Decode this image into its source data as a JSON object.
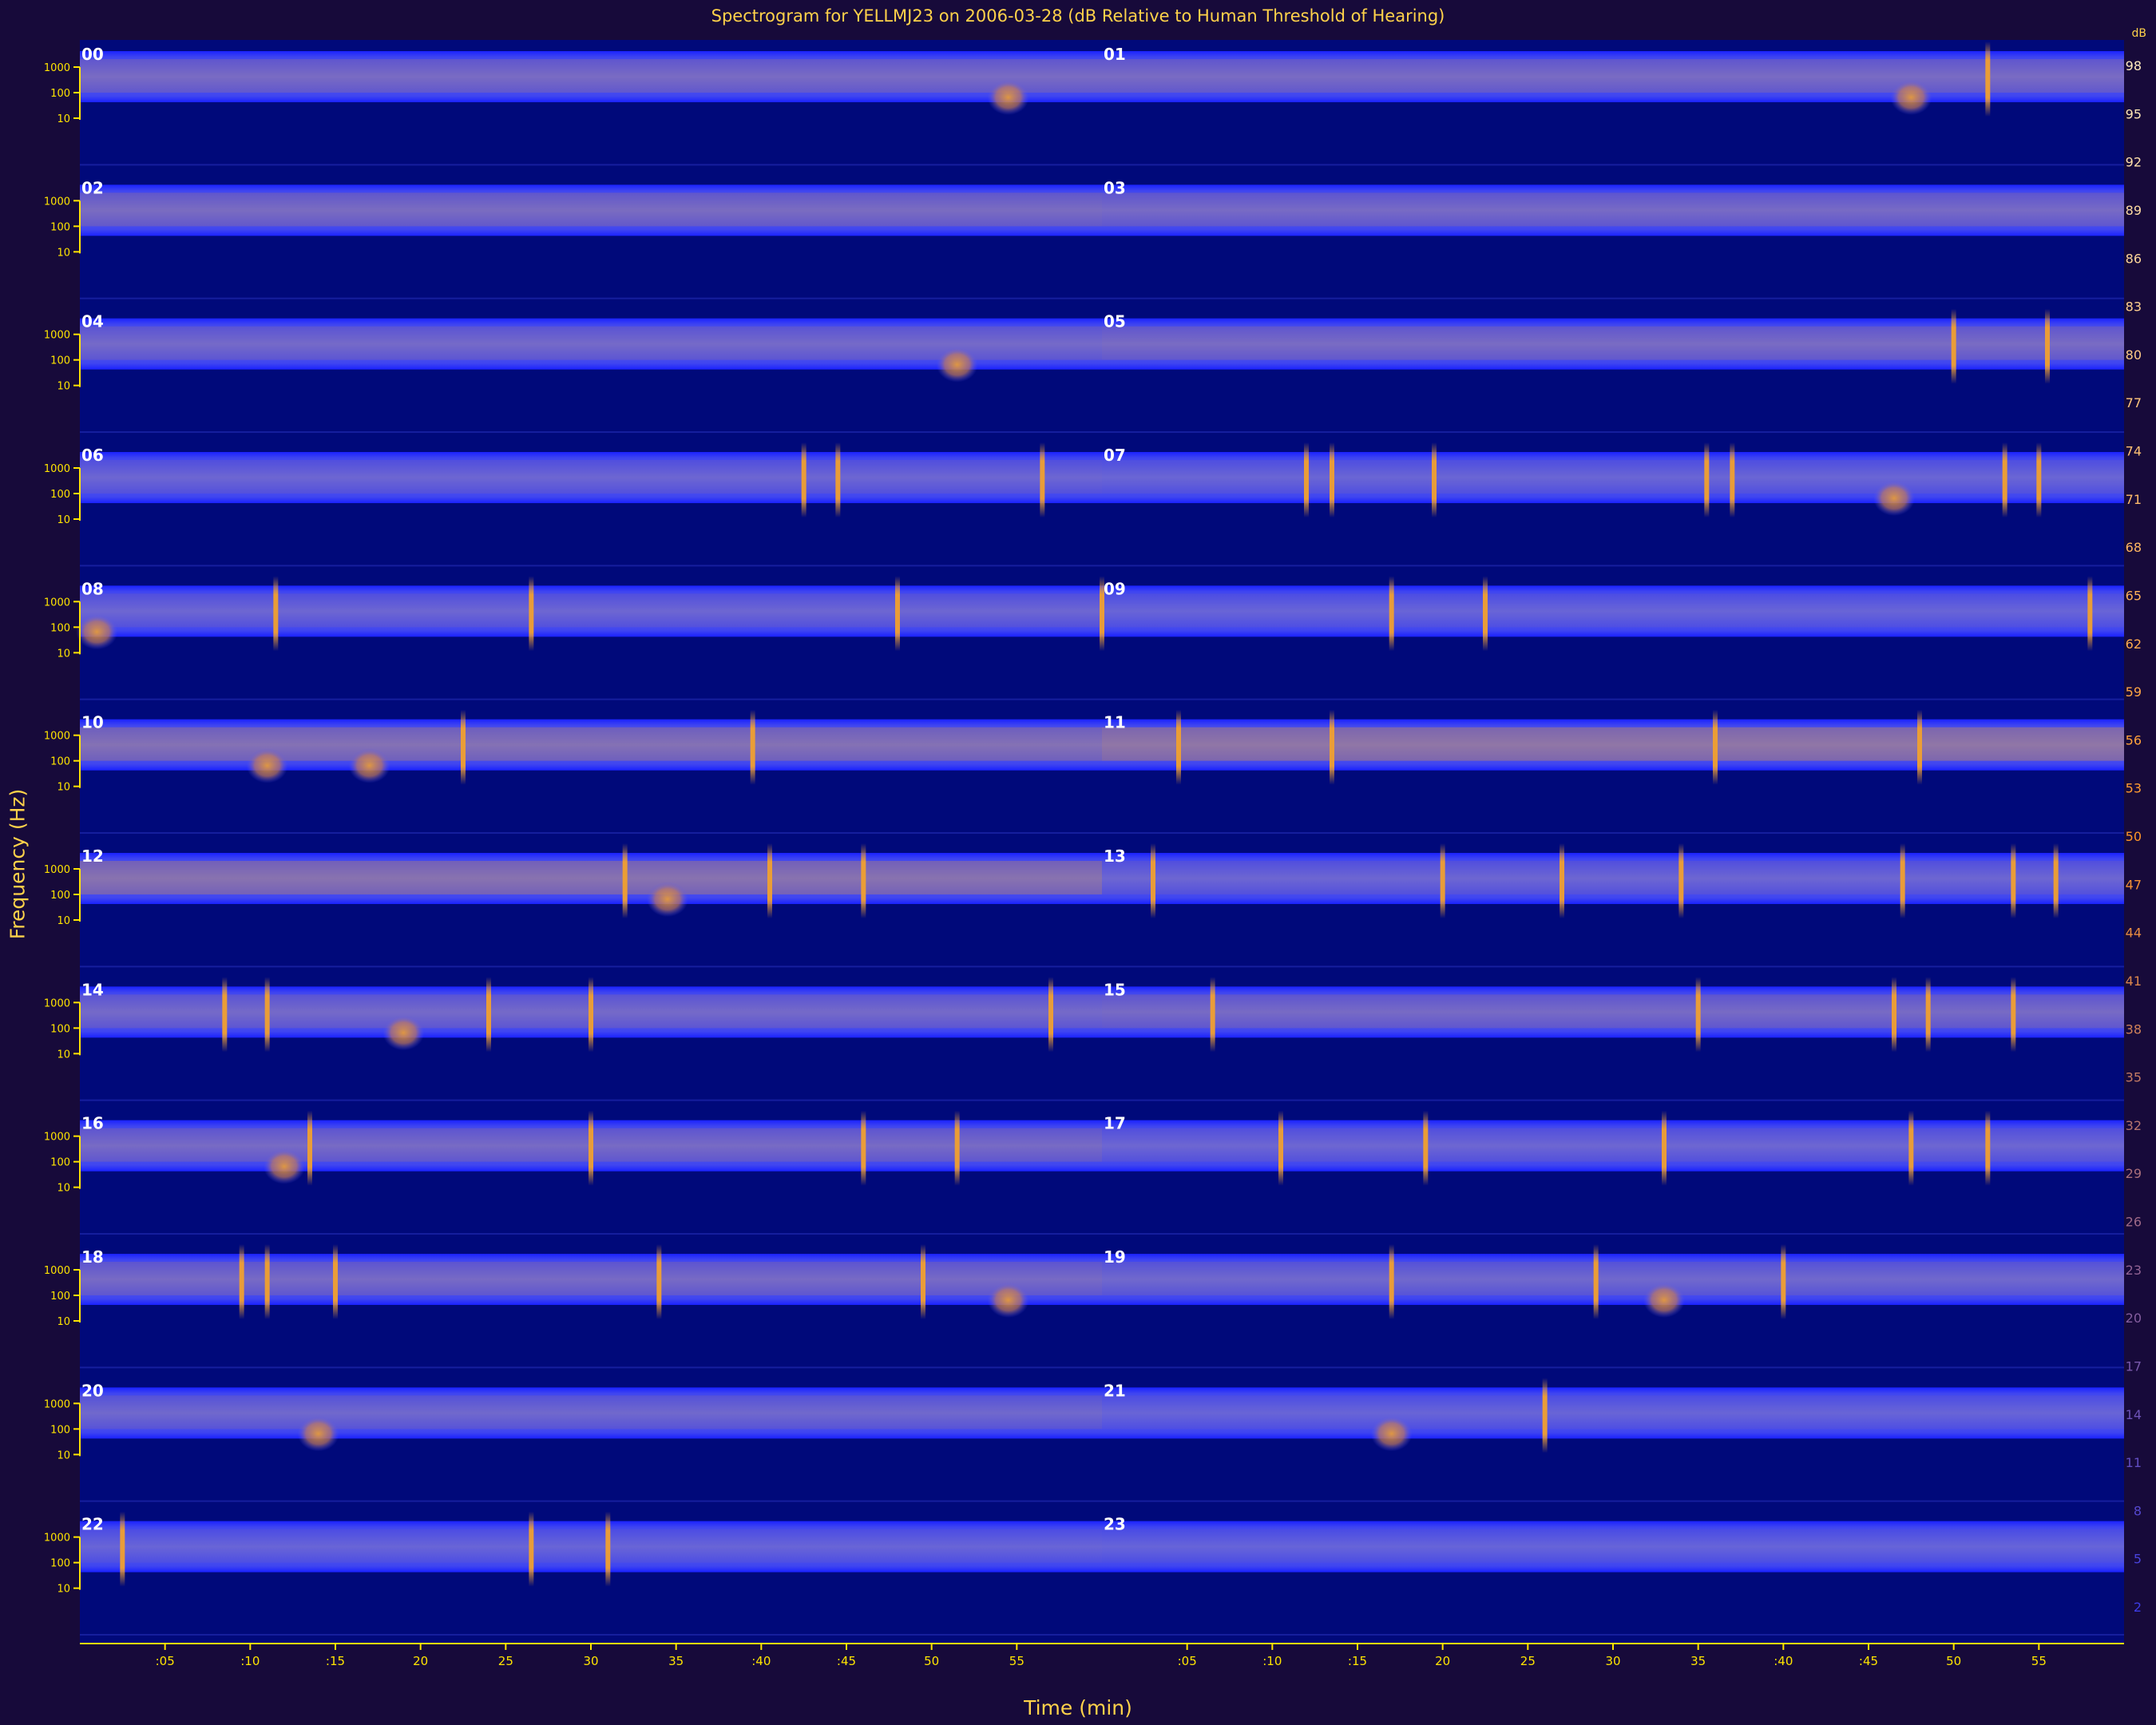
{
  "chart_data": {
    "type": "heatmap",
    "title": "Spectrogram for YELLMJ23 on 2006-03-28 (dB Relative to Human Threshold of Hearing)",
    "xlabel": "Time (min)",
    "ylabel": "Frequency (Hz)",
    "x_tick_labels": [
      ":05",
      ":10",
      ":15",
      "20",
      "25",
      "30",
      "35",
      ":40",
      ":45",
      "50",
      "55"
    ],
    "y_tick_labels": [
      "1000",
      "100",
      "10"
    ],
    "hour_labels": [
      "00",
      "01",
      "02",
      "03",
      "04",
      "05",
      "06",
      "07",
      "08",
      "09",
      "10",
      "11",
      "12",
      "13",
      "14",
      "15",
      "16",
      "17",
      "18",
      "19",
      "20",
      "21",
      "22",
      "23"
    ],
    "colorbar_unit": "dB",
    "colorbar_ticks": [
      98,
      95,
      92,
      89,
      86,
      83,
      80,
      77,
      74,
      71,
      68,
      65,
      62,
      59,
      56,
      53,
      50,
      47,
      44,
      41,
      38,
      35,
      32,
      29,
      26,
      23,
      20,
      17,
      14,
      11,
      8,
      5,
      2
    ],
    "xlim": [
      0,
      60
    ],
    "rows": 12,
    "hours_per_row": 2,
    "band_intensity_by_hour": [
      0.3,
      0.3,
      0.32,
      0.28,
      0.25,
      0.3,
      0.15,
      0.12,
      0.15,
      0.1,
      0.45,
      0.6,
      0.5,
      0.15,
      0.25,
      0.28,
      0.28,
      0.15,
      0.28,
      0.2,
      0.2,
      0.1,
      0.1,
      0.08
    ],
    "events": [
      {
        "hour": 0,
        "minute": 54.5,
        "kind": "blob"
      },
      {
        "hour": 1,
        "minute": 47.5,
        "kind": "blob"
      },
      {
        "hour": 1,
        "minute": 52,
        "kind": "spike"
      },
      {
        "hour": 4,
        "minute": 51.5,
        "kind": "blob"
      },
      {
        "hour": 5,
        "minute": 50,
        "kind": "spike"
      },
      {
        "hour": 5,
        "minute": 55.5,
        "kind": "spike"
      },
      {
        "hour": 6,
        "minute": 42.5,
        "kind": "spike"
      },
      {
        "hour": 6,
        "minute": 44.5,
        "kind": "spike"
      },
      {
        "hour": 6,
        "minute": 56.5,
        "kind": "spike"
      },
      {
        "hour": 7,
        "minute": 12,
        "kind": "spike"
      },
      {
        "hour": 7,
        "minute": 13.5,
        "kind": "spike"
      },
      {
        "hour": 7,
        "minute": 19.5,
        "kind": "spike"
      },
      {
        "hour": 7,
        "minute": 35.5,
        "kind": "spike"
      },
      {
        "hour": 7,
        "minute": 37,
        "kind": "spike"
      },
      {
        "hour": 7,
        "minute": 46.5,
        "kind": "blob"
      },
      {
        "hour": 7,
        "minute": 53,
        "kind": "spike"
      },
      {
        "hour": 7,
        "minute": 55,
        "kind": "spike"
      },
      {
        "hour": 8,
        "minute": 1,
        "kind": "blob"
      },
      {
        "hour": 8,
        "minute": 11.5,
        "kind": "spike"
      },
      {
        "hour": 8,
        "minute": 26.5,
        "kind": "spike"
      },
      {
        "hour": 8,
        "minute": 48,
        "kind": "spike"
      },
      {
        "hour": 9,
        "minute": 0,
        "kind": "spike"
      },
      {
        "hour": 9,
        "minute": 17,
        "kind": "spike"
      },
      {
        "hour": 9,
        "minute": 22.5,
        "kind": "spike"
      },
      {
        "hour": 9,
        "minute": 58,
        "kind": "spike"
      },
      {
        "hour": 10,
        "minute": 11,
        "kind": "blob"
      },
      {
        "hour": 10,
        "minute": 17,
        "kind": "blob"
      },
      {
        "hour": 10,
        "minute": 22.5,
        "kind": "spike"
      },
      {
        "hour": 10,
        "minute": 39.5,
        "kind": "spike"
      },
      {
        "hour": 11,
        "minute": 4.5,
        "kind": "spike"
      },
      {
        "hour": 11,
        "minute": 13.5,
        "kind": "spike"
      },
      {
        "hour": 11,
        "minute": 36,
        "kind": "spike"
      },
      {
        "hour": 11,
        "minute": 48,
        "kind": "spike"
      },
      {
        "hour": 12,
        "minute": 32,
        "kind": "spike"
      },
      {
        "hour": 12,
        "minute": 34.5,
        "kind": "blob"
      },
      {
        "hour": 12,
        "minute": 40.5,
        "kind": "spike"
      },
      {
        "hour": 12,
        "minute": 46,
        "kind": "spike"
      },
      {
        "hour": 13,
        "minute": 3,
        "kind": "spike"
      },
      {
        "hour": 13,
        "minute": 20,
        "kind": "spike"
      },
      {
        "hour": 13,
        "minute": 27,
        "kind": "spike"
      },
      {
        "hour": 13,
        "minute": 34,
        "kind": "spike"
      },
      {
        "hour": 13,
        "minute": 47,
        "kind": "spike"
      },
      {
        "hour": 13,
        "minute": 53.5,
        "kind": "spike"
      },
      {
        "hour": 13,
        "minute": 56,
        "kind": "spike"
      },
      {
        "hour": 14,
        "minute": 8.5,
        "kind": "spike"
      },
      {
        "hour": 14,
        "minute": 11,
        "kind": "spike"
      },
      {
        "hour": 14,
        "minute": 19,
        "kind": "blob"
      },
      {
        "hour": 14,
        "minute": 24,
        "kind": "spike"
      },
      {
        "hour": 14,
        "minute": 30,
        "kind": "spike"
      },
      {
        "hour": 14,
        "minute": 57,
        "kind": "spike"
      },
      {
        "hour": 15,
        "minute": 6.5,
        "kind": "spike"
      },
      {
        "hour": 15,
        "minute": 35,
        "kind": "spike"
      },
      {
        "hour": 15,
        "minute": 46.5,
        "kind": "spike"
      },
      {
        "hour": 15,
        "minute": 48.5,
        "kind": "spike"
      },
      {
        "hour": 15,
        "minute": 53.5,
        "kind": "spike"
      },
      {
        "hour": 16,
        "minute": 12,
        "kind": "blob"
      },
      {
        "hour": 16,
        "minute": 13.5,
        "kind": "spike"
      },
      {
        "hour": 16,
        "minute": 30,
        "kind": "spike"
      },
      {
        "hour": 16,
        "minute": 46,
        "kind": "spike"
      },
      {
        "hour": 16,
        "minute": 51.5,
        "kind": "spike"
      },
      {
        "hour": 17,
        "minute": 10.5,
        "kind": "spike"
      },
      {
        "hour": 17,
        "minute": 19,
        "kind": "spike"
      },
      {
        "hour": 17,
        "minute": 33,
        "kind": "spike"
      },
      {
        "hour": 17,
        "minute": 47.5,
        "kind": "spike"
      },
      {
        "hour": 17,
        "minute": 52,
        "kind": "spike"
      },
      {
        "hour": 18,
        "minute": 9.5,
        "kind": "spike"
      },
      {
        "hour": 18,
        "minute": 11,
        "kind": "spike"
      },
      {
        "hour": 18,
        "minute": 15,
        "kind": "spike"
      },
      {
        "hour": 18,
        "minute": 34,
        "kind": "spike"
      },
      {
        "hour": 18,
        "minute": 49.5,
        "kind": "spike"
      },
      {
        "hour": 18,
        "minute": 54.5,
        "kind": "blob"
      },
      {
        "hour": 19,
        "minute": 17,
        "kind": "spike"
      },
      {
        "hour": 19,
        "minute": 29,
        "kind": "spike"
      },
      {
        "hour": 19,
        "minute": 33,
        "kind": "blob"
      },
      {
        "hour": 19,
        "minute": 40,
        "kind": "spike"
      },
      {
        "hour": 20,
        "minute": 14,
        "kind": "blob"
      },
      {
        "hour": 21,
        "minute": 17,
        "kind": "blob"
      },
      {
        "hour": 21,
        "minute": 26,
        "kind": "spike"
      },
      {
        "hour": 22,
        "minute": 2.5,
        "kind": "spike"
      },
      {
        "hour": 22,
        "minute": 26.5,
        "kind": "spike"
      },
      {
        "hour": 22,
        "minute": 31,
        "kind": "spike"
      }
    ]
  },
  "colors": {
    "background": "#170a3a",
    "plot_background": "#00097a",
    "band_edge": "#1a22ff",
    "band_core": "#5a5ae8",
    "hot": "#f0a030",
    "axis": "#ffe400",
    "text": "#ffd24a"
  }
}
